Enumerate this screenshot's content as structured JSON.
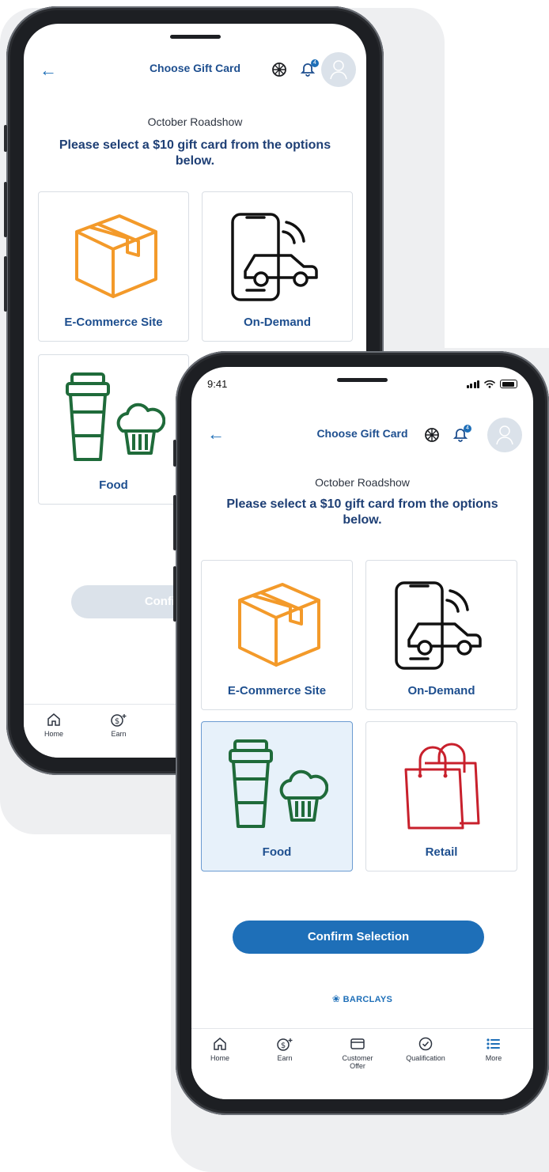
{
  "back_screen": {
    "header": {
      "title": "Choose Gift Card",
      "notification_count": "4"
    },
    "roadshow_title": "October Roadshow",
    "prompt": "Please select a $10 gift card from the options below.",
    "cards": [
      {
        "label": "E-Commerce Site",
        "icon": "box-icon"
      },
      {
        "label": "On-Demand",
        "icon": "phone-car-icon"
      },
      {
        "label": "Food",
        "icon": "coffee-muffin-icon"
      }
    ],
    "confirm_label": "Confirm Selection",
    "tabs": [
      {
        "label": "Home",
        "icon": "home-icon"
      },
      {
        "label": "Earn",
        "icon": "earn-icon"
      }
    ]
  },
  "front_screen": {
    "status_time": "9:41",
    "header": {
      "title": "Choose Gift Card",
      "notification_count": "4"
    },
    "roadshow_title": "October Roadshow",
    "prompt": "Please select a $10 gift card from the options below.",
    "cards": [
      {
        "label": "E-Commerce Site",
        "icon": "box-icon",
        "selected": false
      },
      {
        "label": "On-Demand",
        "icon": "phone-car-icon",
        "selected": false
      },
      {
        "label": "Food",
        "icon": "coffee-muffin-icon",
        "selected": true
      },
      {
        "label": "Retail",
        "icon": "shopping-bag-icon",
        "selected": false
      }
    ],
    "confirm_label": "Confirm Selection",
    "brand": "BARCLAYS",
    "tabs": [
      {
        "label": "Home",
        "icon": "home-icon"
      },
      {
        "label": "Earn",
        "icon": "earn-icon"
      },
      {
        "label": "Customer Offer",
        "icon": "card-icon"
      },
      {
        "label": "Qualification",
        "icon": "check-circle-icon"
      },
      {
        "label": "More",
        "icon": "list-icon"
      }
    ]
  },
  "colors": {
    "primary": "#1e6fb8",
    "title_navy": "#1e4f8f",
    "box_orange": "#f39a2a",
    "food_green": "#1f6b3a",
    "retail_red": "#c8202c",
    "selected_bg": "#e7f1fa",
    "disabled_button": "#dbe2ea"
  }
}
